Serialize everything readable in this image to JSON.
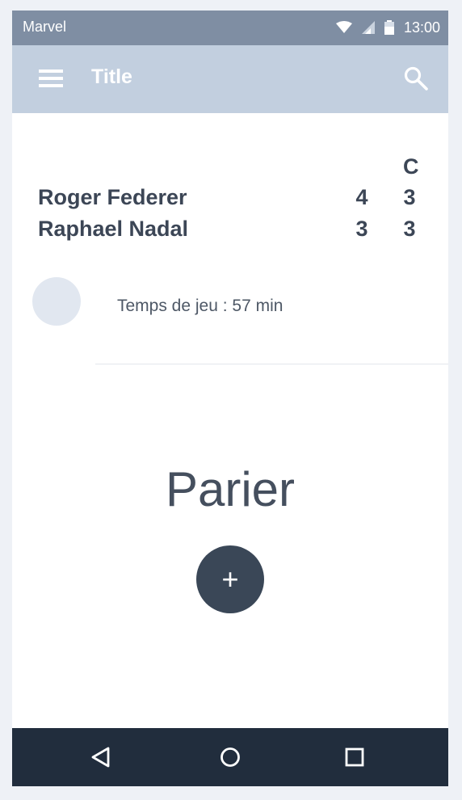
{
  "status_bar": {
    "carrier": "Marvel",
    "time": "13:00",
    "icons": [
      "wifi-icon",
      "signal-icon",
      "battery-icon"
    ]
  },
  "app_bar": {
    "title": "Title",
    "icons": [
      "menu-icon",
      "search-icon"
    ]
  },
  "scoreboard": {
    "column_header": "C",
    "players": [
      {
        "name": "Roger Federer",
        "score1": "4",
        "score2": "3"
      },
      {
        "name": "Raphael Nadal",
        "score1": "3",
        "score2": "3"
      }
    ]
  },
  "match_info": {
    "play_time": "Temps de jeu : 57 min"
  },
  "bet": {
    "label": "Parier",
    "add_button_symbol": "+"
  },
  "nav_bar": {
    "icons": [
      "back-icon",
      "home-icon",
      "recents-icon"
    ]
  },
  "colors": {
    "status_bar": "#7f8ea3",
    "app_bar": "#c2cfdf",
    "nav_bar": "#212d3d",
    "fab": "#3a4757",
    "text_dark": "#3c4656"
  }
}
